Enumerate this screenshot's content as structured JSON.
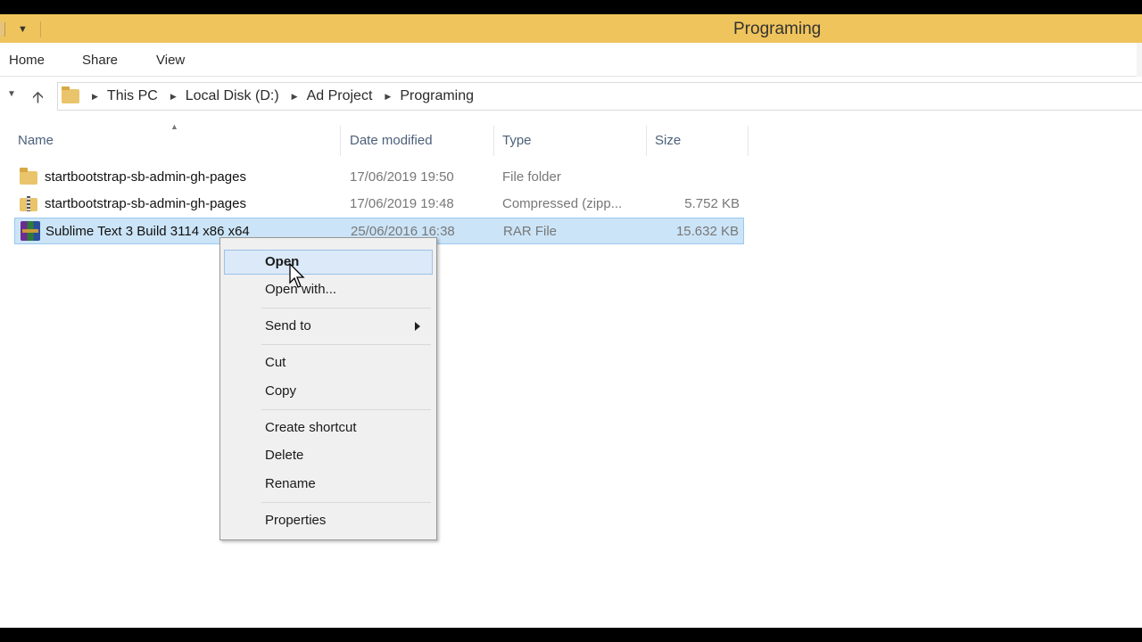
{
  "window": {
    "title": "Programing"
  },
  "ribbon": {
    "tabs": [
      "Home",
      "Share",
      "View"
    ]
  },
  "address": {
    "crumbs": [
      "This PC",
      "Local Disk (D:)",
      "Ad Project",
      "Programing"
    ]
  },
  "columns": {
    "name": "Name",
    "date": "Date modified",
    "type": "Type",
    "size": "Size"
  },
  "files": [
    {
      "name": "startbootstrap-sb-admin-gh-pages",
      "date": "17/06/2019 19:50",
      "type": "File folder",
      "size": "",
      "icon": "folder-icon"
    },
    {
      "name": "startbootstrap-sb-admin-gh-pages",
      "date": "17/06/2019 19:48",
      "type": "Compressed (zipp...",
      "size": "5.752 KB",
      "icon": "zip-folder-icon"
    },
    {
      "name": "Sublime Text 3 Build 3114 x86 x64",
      "date": "25/06/2016 16:38",
      "type": "RAR File",
      "size": "15.632 KB",
      "icon": "winrar-archive-icon",
      "selected": true
    }
  ],
  "context_menu": {
    "items": [
      {
        "label": "Open",
        "hover": true
      },
      {
        "label": "Open with..."
      },
      {
        "label": "Send to",
        "submenu": true
      },
      {
        "label": "Cut"
      },
      {
        "label": "Copy"
      },
      {
        "label": "Create shortcut"
      },
      {
        "label": "Delete"
      },
      {
        "label": "Rename"
      },
      {
        "label": "Properties"
      }
    ]
  },
  "colors": {
    "titlebar": "#f0c45c",
    "selection": "#cce4f7",
    "menu_background": "#f0f0f0",
    "menu_hover": "#dbe9f8"
  }
}
